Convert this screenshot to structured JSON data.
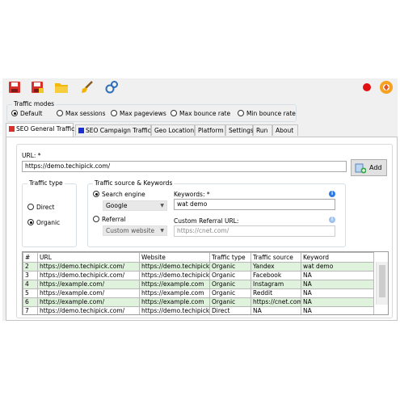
{
  "colors": {
    "row_highlight": "#dff3dc",
    "accent_blue": "#2c7be5",
    "record_red": "#e11010"
  },
  "toolbar": {
    "buttons": [
      "save-icon",
      "save-as-icon",
      "open-folder-icon",
      "clear-brush-icon",
      "settings-gears-icon"
    ],
    "right": [
      "record-icon",
      "app-logo-icon"
    ]
  },
  "traffic_modes": {
    "title": "Traffic modes",
    "options": [
      "Default",
      "Max sessions",
      "Max pageviews",
      "Max bounce rate",
      "Min bounce rate"
    ],
    "selected": "Default"
  },
  "tabs": [
    "SEO General Traffic",
    "SEO Campaign Traffic",
    "Geo Location",
    "Platform",
    "Settings",
    "Run",
    "About"
  ],
  "active_tab": "SEO General Traffic",
  "form": {
    "url_label": "URL: *",
    "url_value": "https://demo.techipick.com/",
    "add_button": "Add",
    "traffic_type": {
      "title": "Traffic type",
      "direct": "Direct",
      "organic": "Organic",
      "selected": "Organic"
    },
    "source": {
      "title": "Traffic source & Keywords",
      "search_engine": "Search engine",
      "search_engine_value": "Google",
      "referral": "Referral",
      "referral_value": "Custom website",
      "keywords_label": "Keywords: *",
      "keywords_value": "wat demo",
      "custom_url_label": "Custom Referral URL:",
      "custom_url_placeholder": "https://cnet.com/"
    }
  },
  "table": {
    "columns": [
      "#",
      "URL",
      "Website",
      "Traffic type",
      "Traffic source",
      "Keyword"
    ],
    "rows": [
      [
        "2",
        "https://demo.techipick.com/",
        "https://demo.techipick.co",
        "Organic",
        "Yandex",
        "wat demo"
      ],
      [
        "3",
        "https://demo.techipick.com/",
        "https://demo.techipick.co",
        "Organic",
        "Facebook",
        "NA"
      ],
      [
        "4",
        "https://example.com/",
        "https://example.com",
        "Organic",
        "Instagram",
        "NA"
      ],
      [
        "5",
        "https://example.com/",
        "https://example.com",
        "Organic",
        "Reddit",
        "NA"
      ],
      [
        "6",
        "https://example.com/",
        "https://example.com",
        "Organic",
        "https://cnet.com/",
        "NA"
      ],
      [
        "7",
        "https://demo.techipick.com/",
        "https://demo.techipick.co",
        "Direct",
        "NA",
        "NA"
      ]
    ]
  }
}
